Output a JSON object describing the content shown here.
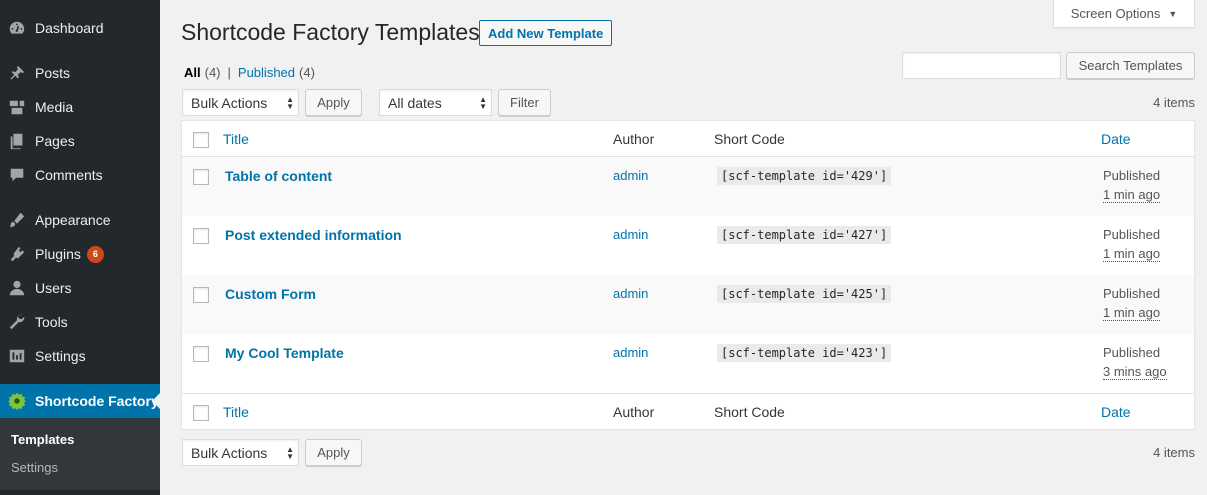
{
  "sidebar": {
    "items": [
      {
        "label": "Dashboard",
        "icon": "dashboard-icon"
      },
      {
        "label": "Posts",
        "icon": "pin-icon"
      },
      {
        "label": "Media",
        "icon": "media-icon"
      },
      {
        "label": "Pages",
        "icon": "pages-icon"
      },
      {
        "label": "Comments",
        "icon": "comments-icon"
      },
      {
        "label": "Appearance",
        "icon": "brush-icon"
      },
      {
        "label": "Plugins",
        "icon": "plugin-icon",
        "badge": "6"
      },
      {
        "label": "Users",
        "icon": "users-icon"
      },
      {
        "label": "Tools",
        "icon": "wrench-icon"
      },
      {
        "label": "Settings",
        "icon": "settings-icon"
      },
      {
        "label": "Shortcode Factory",
        "icon": "gear-icon"
      }
    ],
    "submenu": [
      {
        "label": "Templates"
      },
      {
        "label": "Settings"
      }
    ]
  },
  "header": {
    "title": "Shortcode Factory Templates",
    "add_new_label": "Add New Template",
    "screen_options_label": "Screen Options",
    "screen_options_caret": "▼"
  },
  "filters": {
    "all_label": "All",
    "all_count": "(4)",
    "separator": "|",
    "published_label": "Published",
    "published_count": "(4)"
  },
  "search": {
    "value": "",
    "button_label": "Search Templates"
  },
  "tablenav_top": {
    "bulk_actions": "Bulk Actions",
    "apply_label": "Apply",
    "date_filter": "All dates",
    "filter_label": "Filter",
    "items_count": "4 items"
  },
  "tablenav_bottom": {
    "bulk_actions": "Bulk Actions",
    "apply_label": "Apply",
    "items_count": "4 items"
  },
  "table": {
    "columns": [
      "Title",
      "Author",
      "Short Code",
      "Date"
    ],
    "rows": [
      {
        "title": "Table of content",
        "author": "admin",
        "shortcode": "[scf-template id='429']",
        "status": "Published",
        "when": "1 min ago"
      },
      {
        "title": "Post extended information",
        "author": "admin",
        "shortcode": "[scf-template id='427']",
        "status": "Published",
        "when": "1 min ago"
      },
      {
        "title": "Custom Form",
        "author": "admin",
        "shortcode": "[scf-template id='425']",
        "status": "Published",
        "when": "1 min ago"
      },
      {
        "title": "My Cool Template",
        "author": "admin",
        "shortcode": "[scf-template id='423']",
        "status": "Published",
        "when": "3 mins ago"
      }
    ]
  },
  "colors": {
    "sidebar_bg": "#23282d",
    "accent": "#0073aa",
    "badge": "#ca4a1f",
    "page_bg": "#f1f1f1"
  }
}
